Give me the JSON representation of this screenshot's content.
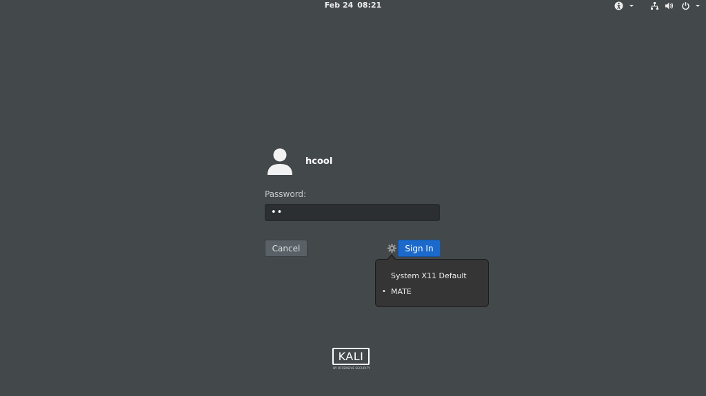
{
  "topbar": {
    "date": "Feb 24",
    "time": "08:21",
    "icons": [
      "accessibility-icon",
      "network-icon",
      "volume-icon",
      "power-icon"
    ]
  },
  "login": {
    "username": "hcool",
    "password_label": "Password:",
    "password_value": "••",
    "cancel_label": "Cancel",
    "signin_label": "Sign In"
  },
  "session_menu": {
    "items": [
      {
        "label": "System X11 Default",
        "selected": false
      },
      {
        "label": "MATE",
        "selected": true
      }
    ],
    "bullet": "•"
  },
  "logo": {
    "brand": "KALI",
    "tagline": "BY OFFENSIVE SECURITY"
  },
  "colors": {
    "background": "#43484b",
    "accent": "#1b6acb",
    "popup": "#353535"
  }
}
